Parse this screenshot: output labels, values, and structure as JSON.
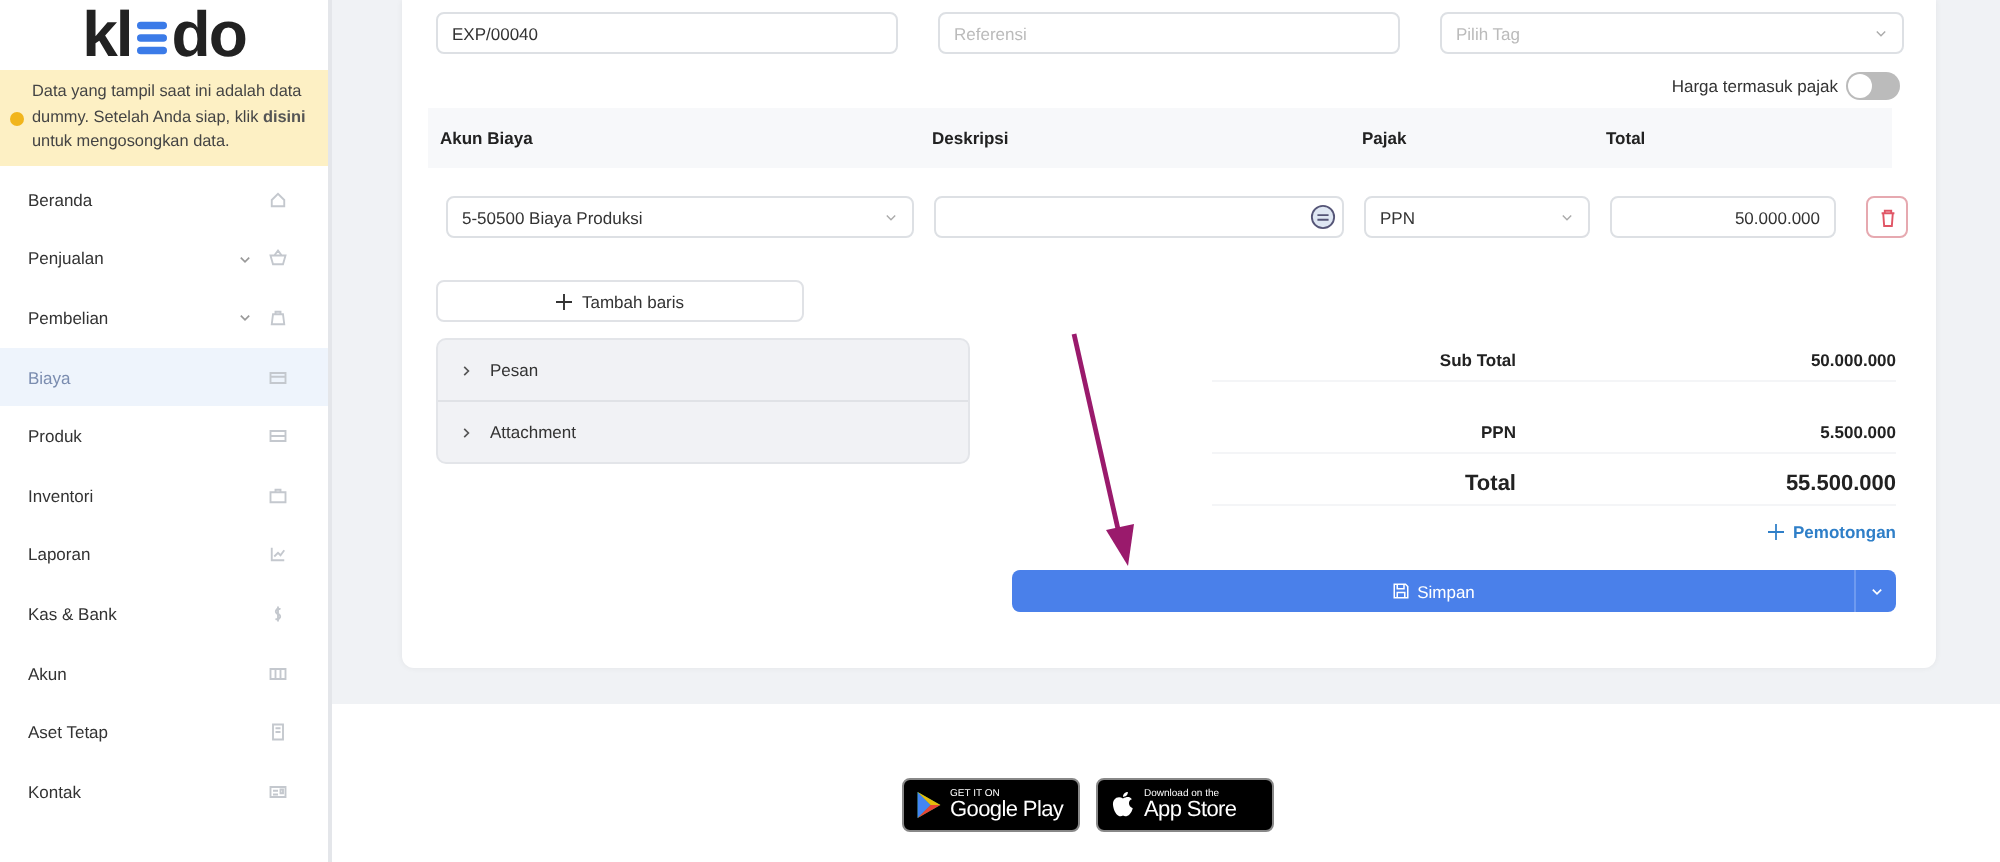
{
  "logo": {
    "left": "kl",
    "right": "do"
  },
  "notice": {
    "before": "Data yang tampil saat ini adalah data dummy. Setelah Anda siap, klik ",
    "link": "disini",
    "after": " untuk mengosongkan data."
  },
  "sidebar": {
    "items": [
      {
        "label": "Beranda",
        "selected": false
      },
      {
        "label": "Penjualan",
        "selected": false,
        "expanded": false
      },
      {
        "label": "Pembelian",
        "selected": false,
        "expanded": false
      },
      {
        "label": "Biaya",
        "selected": true
      },
      {
        "label": "Produk",
        "selected": false
      },
      {
        "label": "Inventori",
        "selected": false
      },
      {
        "label": "Laporan",
        "selected": false
      },
      {
        "label": "Kas & Bank",
        "selected": false
      },
      {
        "label": "Akun",
        "selected": false
      },
      {
        "label": "Aset Tetap",
        "selected": false
      },
      {
        "label": "Kontak",
        "selected": false
      }
    ]
  },
  "form": {
    "number": {
      "value": "EXP/00040"
    },
    "reference": {
      "placeholder": "Referensi"
    },
    "tag": {
      "placeholder": "Pilih Tag"
    },
    "tax_inclusive": {
      "label": "Harga termasuk pajak",
      "on": false
    }
  },
  "table": {
    "columns": [
      "Akun Biaya",
      "Deskripsi",
      "Pajak",
      "Total"
    ],
    "rows": [
      {
        "account": "5-50500 Biaya Produksi",
        "description": "",
        "tax": "PPN",
        "total": "50.000.000"
      }
    ]
  },
  "add_row": "Tambah baris",
  "accordion": [
    {
      "label": "Pesan",
      "expanded": false
    },
    {
      "label": "Attachment",
      "expanded": false
    }
  ],
  "summary": [
    {
      "kind": "normal",
      "label": "Sub Total",
      "value": "50.000.000"
    },
    {
      "kind": "normal",
      "label": "PPN",
      "value": "5.500.000"
    },
    {
      "kind": "grand",
      "label": "Total",
      "value": "55.500.000"
    }
  ],
  "deduction_link": "Pemotongan",
  "save_button": "Simpan",
  "stores": [
    {
      "kind": "google",
      "small": "GET IT ON",
      "big": "Google Play"
    },
    {
      "kind": "apple",
      "small": "Download on the",
      "big": "App Store"
    }
  ]
}
